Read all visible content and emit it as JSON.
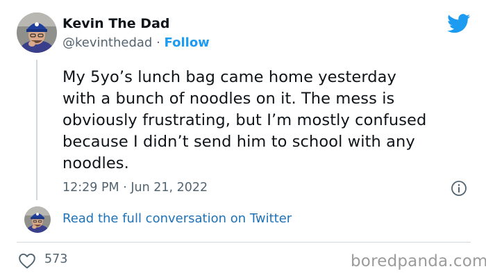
{
  "author": {
    "name": "Kevin The Dad",
    "handle": "@kevinthedad",
    "separator": "·",
    "follow_label": "Follow"
  },
  "tweet": {
    "text": "My 5yo’s lunch bag came home yesterday\nwith a bunch of noodles on it. The mess is\nobviously frustrating, but I’m mostly confused\nbecause I didn’t send him to school with any\nnoodles.",
    "timestamp": "12:29 PM · Jun 21, 2022"
  },
  "conversation": {
    "link_label": "Read the full conversation on Twitter"
  },
  "engagement": {
    "likes": "573"
  },
  "watermark": "boredpanda.com",
  "icons": {
    "brand": "twitter-bird-icon",
    "info": "info-icon",
    "like": "heart-icon"
  },
  "colors": {
    "twitter_blue": "#1d9bf0",
    "text_primary": "#0f1419",
    "text_secondary": "#536471",
    "link": "#1d72b8",
    "border": "#cfd9de",
    "watermark": "#9b9b9b"
  }
}
